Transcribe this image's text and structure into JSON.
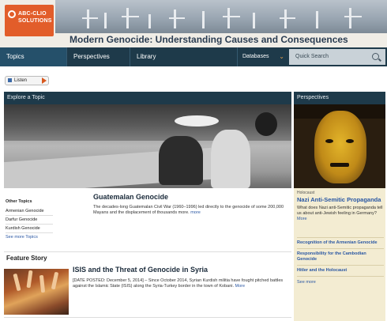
{
  "header": {
    "logo_text": "ABC-CLIO SOLUTIONS",
    "title": "Modern Genocide: Understanding Causes and Consequences"
  },
  "nav": {
    "tabs": [
      "Topics",
      "Perspectives",
      "Library"
    ],
    "databases_label": "Databases",
    "search_placeholder": "Quick Search"
  },
  "listen": {
    "label": "Listen"
  },
  "explore": {
    "heading": "Explore a Topic",
    "topic_title": "Guatemalan Genocide",
    "topic_desc": "The decades-long Guatemalan Civil War (1960–1996) led directly to the genocide of some 200,000 Mayans and the displacement of thousands more.",
    "more_label": "more",
    "other_topics": {
      "heading": "Other Topics",
      "items": [
        "Armenian Genocide",
        "Darfur Genocide",
        "Kurdish Genocide"
      ],
      "see_more": "See more Topics"
    }
  },
  "feature": {
    "heading": "Feature Story",
    "title": "ISIS and the Threat of Genocide in Syria",
    "desc": "[DATE POSTED: December 5, 2014] – Since October 2014, Syrian Kurdish militia have fought pitched battles against the Islamic State (ISIS) along the Syria-Turkey border in the town of Kobani.",
    "more_label": "More"
  },
  "perspectives": {
    "heading": "Perspectives",
    "category": "Holocaust",
    "title": "Nazi Anti-Semitic Propaganda",
    "question": "What does Nazi anti-Semitic propaganda tell us about anti-Jewish feeling in Germany?",
    "more_label": "More",
    "links": [
      "Recognition of the Armenian Genocide",
      "Responsibility for the Cambodian Genocide",
      "Hitler and the Holocaust"
    ],
    "see_more": "See more"
  },
  "colors": {
    "nav_bg": "#1e3a4a",
    "logo_orange": "#e25d2a",
    "link_blue": "#2a57a3",
    "sidebar_bg": "#f3ecd2"
  }
}
